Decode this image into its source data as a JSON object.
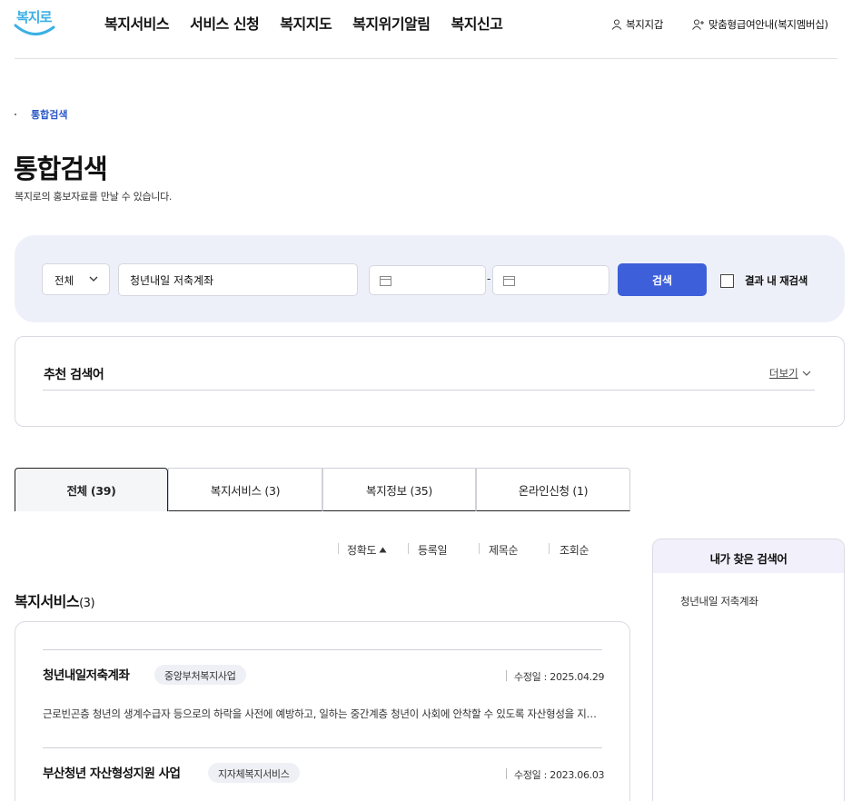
{
  "header": {
    "logo_text": "복지로",
    "nav": [
      "복지서비스",
      "서비스 신청",
      "복지지도",
      "복지위기알림",
      "복지신고"
    ],
    "util_wallet": "복지지갑",
    "util_notice": "맞춤형급여안내(복지멤버십)"
  },
  "breadcrumb": {
    "current": "통합검색"
  },
  "page": {
    "title": "통합검색",
    "description": "복지로의 홍보자료를 만날 수 있습니다."
  },
  "search": {
    "scope": "전체",
    "keyword": "청년내일 저축계좌",
    "date_from": "",
    "date_to": "",
    "date_separator": "-",
    "button": "검색",
    "refine_label": "결과 내 재검색"
  },
  "recommend": {
    "title": "추천 검색어",
    "more": "더보기"
  },
  "tabs": [
    {
      "label": "전체 (39)"
    },
    {
      "label": "복지서비스 (3)"
    },
    {
      "label": "복지정보 (35)"
    },
    {
      "label": "온라인신청 (1)"
    }
  ],
  "sort": [
    "정확도",
    "등록일",
    "제목순",
    "조회순"
  ],
  "section": {
    "title": "복지서비스",
    "count": "(3)"
  },
  "results": [
    {
      "title": "청년내일저축계좌",
      "tag": "중앙부처복지사업",
      "date": "수정일 : 2025.04.29",
      "description": "근로빈곤층 청년의 생계수급자 등으로의 하락을 사전에 예방하고, 일하는 중간계층 청년이 사회에 안착할 수 있도록 자산형성을 지원합니다."
    },
    {
      "title": "부산청년 자산형성지원 사업",
      "tag": "지자체복지서비스",
      "date": "수정일 : 2023.06.03"
    }
  ],
  "side": {
    "title": "내가 찾은 검색어",
    "items": [
      "청년내일 저축계좌"
    ]
  },
  "colors": {
    "primary": "#3d5fd9",
    "logo": "#3bb0e6",
    "panel": "#eef0f9"
  }
}
